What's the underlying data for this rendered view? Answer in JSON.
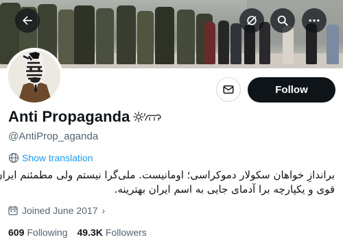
{
  "profile": {
    "display_name": "Anti Propaganda",
    "handle": "@AntiProp_aganda",
    "show_translation": "Show translation",
    "bio_lines": [
      "براندازِ خواهان سکولار دموکراسی؛ اومانیست. ملی‌گرا نیستم ولی مطمئنم ایران",
      "قوی و یکپارچه برا آدمای جایی به اسم ایران بهترینه."
    ],
    "joined": "Joined June 2017"
  },
  "actions": {
    "follow_label": "Follow"
  },
  "stats": {
    "following_count": "609",
    "following_label": "Following",
    "followers_count": "49.3K",
    "followers_label": "Followers"
  },
  "icons": {
    "back": "back-arrow-icon",
    "hide": "eye-off-icon",
    "search": "search-icon",
    "more": "more-icon",
    "message": "envelope-icon",
    "translate": "globe-icon",
    "calendar": "calendar-icon",
    "emoji_sun": "sun-icon",
    "emoji_lion": "lion-icon"
  },
  "colors": {
    "link": "#1d9bf0",
    "secondary_text": "#536471",
    "follow_bg": "#0f1419"
  }
}
